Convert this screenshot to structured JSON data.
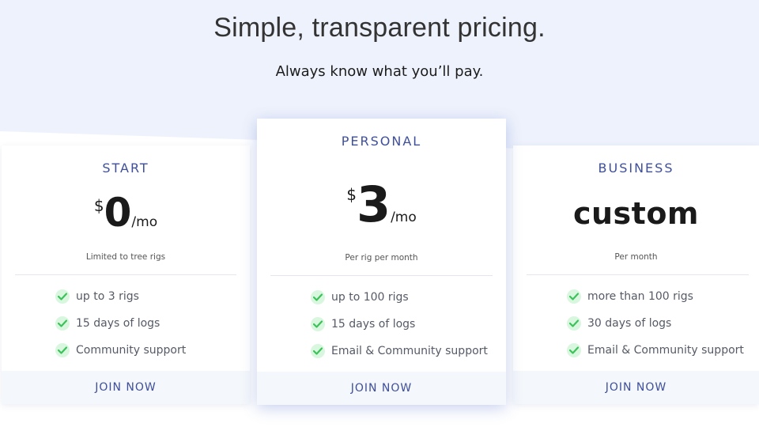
{
  "header": {
    "title": "Simple, transparent pricing.",
    "subtitle": "Always know what you’ll pay."
  },
  "plans": [
    {
      "name": "START",
      "currency": "$",
      "amount": "0",
      "period": "/mo",
      "note": "Limited to tree rigs",
      "features": [
        "up to 3 rigs",
        "15 days of logs",
        "Community support"
      ],
      "cta": "JOIN NOW"
    },
    {
      "name": "PERSONAL",
      "currency": "$",
      "amount": "3",
      "period": "/mo",
      "note": "Per rig per month",
      "features": [
        "up to 100 rigs",
        "15 days of logs",
        "Email & Community support"
      ],
      "cta": "JOIN NOW"
    },
    {
      "name": "BUSINESS",
      "price_text": "custom",
      "note": "Per month",
      "features": [
        "more than 100 rigs",
        "30 days of logs",
        "Email & Community support"
      ],
      "cta": "JOIN NOW"
    }
  ],
  "colors": {
    "accent": "#3f4f9a",
    "background": "#eef2fc",
    "check_bg": "#d9f7df",
    "check_mark": "#3cc25a"
  }
}
